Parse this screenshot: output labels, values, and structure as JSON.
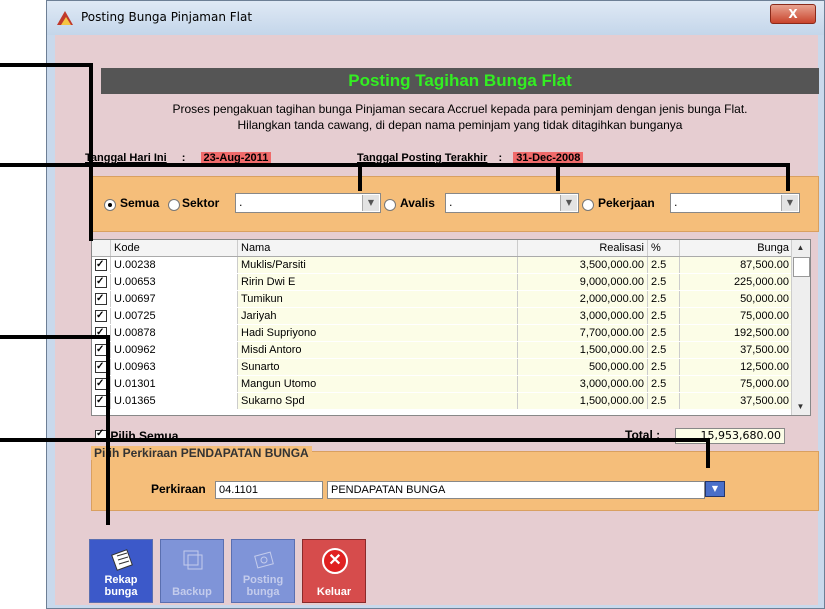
{
  "window": {
    "title": "Posting Bunga Pinjaman Flat",
    "close_label": "X"
  },
  "header": {
    "title": "Posting Tagihan Bunga Flat",
    "desc_line1": "Proses pengakuan tagihan bunga Pinjaman secara Accruel kepada para peminjam dengan jenis bunga Flat.",
    "desc_line2": "Hilangkan tanda cawang, di depan nama peminjam yang tidak ditagihkan bunganya"
  },
  "info": {
    "today_label": "Tanggal Hari Ini",
    "separator": ":",
    "today_value": "23-Aug-2011",
    "last_posting_label": "Tanggal Posting Terakhir",
    "last_posting_value": "31-Dec-2008"
  },
  "filters": {
    "semua_label": "Semua",
    "sektor_label": "Sektor",
    "avalis_label": "Avalis",
    "pekerjaan_label": "Pekerjaan",
    "sektor_value": ".",
    "avalis_value": ".",
    "pekerjaan_value": ".",
    "selected": "Semua"
  },
  "grid": {
    "columns": [
      "Kode",
      "Nama",
      "Realisasi",
      "%",
      "Bunga"
    ],
    "rows": [
      {
        "kode": "U.00238",
        "nama": "Muklis/Parsiti",
        "realisasi": "3,500,000.00",
        "persen": "2.5",
        "bunga": "87,500.00",
        "checked": true
      },
      {
        "kode": "U.00653",
        "nama": "Ririn Dwi E",
        "realisasi": "9,000,000.00",
        "persen": "2.5",
        "bunga": "225,000.00",
        "checked": true
      },
      {
        "kode": "U.00697",
        "nama": "Tumikun",
        "realisasi": "2,000,000.00",
        "persen": "2.5",
        "bunga": "50,000.00",
        "checked": true
      },
      {
        "kode": "U.00725",
        "nama": "Jariyah",
        "realisasi": "3,000,000.00",
        "persen": "2.5",
        "bunga": "75,000.00",
        "checked": true
      },
      {
        "kode": "U.00878",
        "nama": "Hadi Supriyono",
        "realisasi": "7,700,000.00",
        "persen": "2.5",
        "bunga": "192,500.00",
        "checked": true
      },
      {
        "kode": "U.00962",
        "nama": "Misdi Antoro",
        "realisasi": "1,500,000.00",
        "persen": "2.5",
        "bunga": "37,500.00",
        "checked": true
      },
      {
        "kode": "U.00963",
        "nama": "Sunarto",
        "realisasi": "500,000.00",
        "persen": "2.5",
        "bunga": "12,500.00",
        "checked": true
      },
      {
        "kode": "U.01301",
        "nama": "Mangun Utomo",
        "realisasi": "3,000,000.00",
        "persen": "2.5",
        "bunga": "75,000.00",
        "checked": true
      },
      {
        "kode": "U.01365",
        "nama": "Sukarno Spd",
        "realisasi": "1,500,000.00",
        "persen": "2.5",
        "bunga": "37,500.00",
        "checked": true
      }
    ]
  },
  "footer": {
    "pilih_semua_label": "Pilih Semua",
    "total_label": "Total :",
    "total_value": "15,953,680.00"
  },
  "perkiraan": {
    "group_title": "Pilih Perkiraan PENDAPATAN BUNGA",
    "label": "Perkiraan",
    "code": "04.1101",
    "name": "PENDAPATAN BUNGA"
  },
  "toolbar": {
    "rekap_label_1": "Rekap",
    "rekap_label_2": "bunga",
    "backup_label": "Backup",
    "posting_label_1": "Posting",
    "posting_label_2": "bunga",
    "keluar_label": "Keluar"
  },
  "colors": {
    "header_bg": "#555555",
    "header_text": "#33ee22",
    "panel": "#f5be7a",
    "pink": "#e6cdd1",
    "date_highlight": "#f06a6a"
  }
}
